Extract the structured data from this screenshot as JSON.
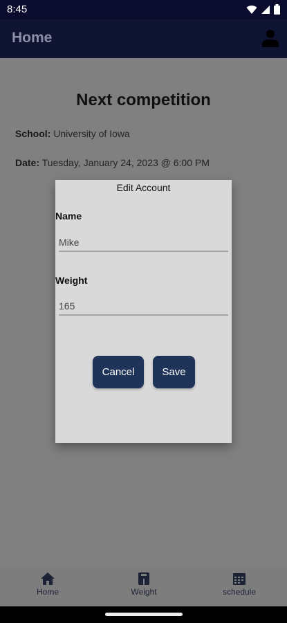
{
  "status_bar": {
    "time": "8:45",
    "icons": [
      "wifi-icon",
      "signal-icon",
      "battery-icon"
    ]
  },
  "app_bar": {
    "title": "Home",
    "profile_icon": "person-icon"
  },
  "content": {
    "heading": "Next competition",
    "school_label": "School:",
    "school_value": "University of Iowa",
    "date_label": "Date:",
    "date_value": "Tuesday, January 24, 2023 @ 6:00 PM"
  },
  "dialog": {
    "title": "Edit Account",
    "name_label": "Name",
    "name_value": "Mike",
    "weight_label": "Weight",
    "weight_value": "165",
    "cancel_label": "Cancel",
    "save_label": "Save"
  },
  "bottom_nav": {
    "items": [
      {
        "label": "Home",
        "icon": "home-icon"
      },
      {
        "label": "Weight",
        "icon": "weight-icon"
      },
      {
        "label": "schedule",
        "icon": "calendar-icon"
      }
    ]
  },
  "colors": {
    "app_bar": "#0f1432",
    "button": "#1f3458",
    "dialog_bg": "#d9d9d9",
    "scrim": "#808080"
  }
}
